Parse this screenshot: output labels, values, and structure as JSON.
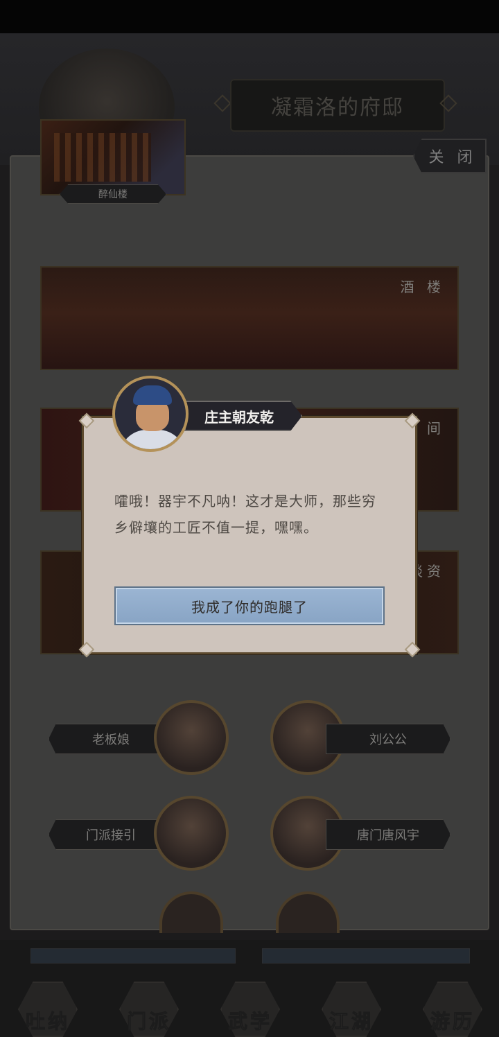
{
  "header": {
    "residence_title": "凝霜洛的府邸"
  },
  "panel": {
    "close_label": "关 闭",
    "location_label": "醉仙楼",
    "venues": [
      {
        "label": "酒 楼"
      },
      {
        "label": "雅 间"
      },
      {
        "label": "谈资"
      }
    ],
    "npcs": [
      {
        "left": "老板娘",
        "right": "刘公公"
      },
      {
        "left": "门派接引",
        "right": "唐门唐风宇"
      }
    ]
  },
  "dialog": {
    "speaker_name": "庄主朝友乾",
    "text_line1": "嚯哦！器宇不凡呐！这才是大师，那些穷",
    "text_line2": "乡僻壤的工匠不值一提，嘿嘿。",
    "reply_label": "我成了你的跑腿了"
  },
  "bottom_nav": {
    "items": [
      "吐纳",
      "门派",
      "武学",
      "江湖",
      "游历"
    ]
  },
  "colors": {
    "dialog_bg": "#cec4bc",
    "reply_button": "#93afcf",
    "gold_border": "#b49259"
  }
}
